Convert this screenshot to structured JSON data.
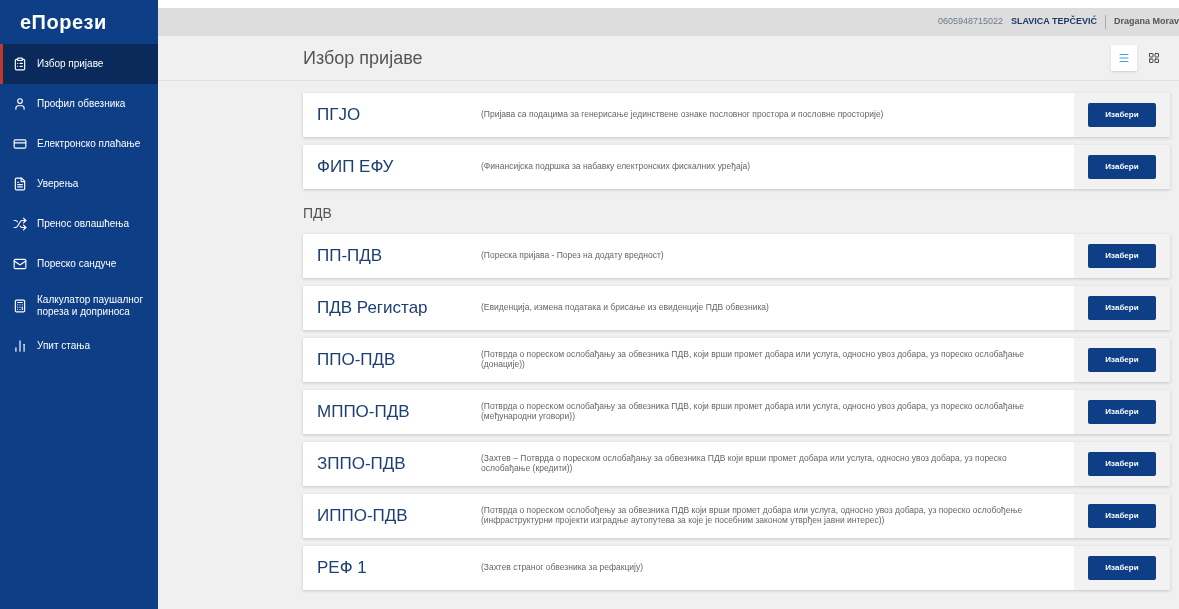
{
  "logo": "еПорези",
  "sidebar": {
    "items": [
      {
        "kind": "list",
        "label": "Избор пријаве",
        "selected": true
      },
      {
        "kind": "profile",
        "label": "Профил обвезника",
        "selected": false
      },
      {
        "kind": "card",
        "label": "Електронско плаћање",
        "selected": false
      },
      {
        "kind": "certificate",
        "label": "Уверења",
        "selected": false
      },
      {
        "kind": "transfer",
        "label": "Пренос овлашћења",
        "selected": false
      },
      {
        "kind": "mail",
        "label": "Пореско сандуче",
        "selected": false
      },
      {
        "kind": "calculator",
        "label": "Калкулатор паушалног пореза и доприноса",
        "selected": false
      },
      {
        "kind": "chart",
        "label": "Упит стања",
        "selected": false
      }
    ]
  },
  "header": {
    "id_number": "0605948715022",
    "user_name": "SLAVICA TEPČEVIĆ",
    "other_user": "Dragana Morav"
  },
  "page_title": "Избор пријаве",
  "view_toggle": [
    {
      "kind": "list",
      "selected": true
    },
    {
      "kind": "grid",
      "selected": false
    }
  ],
  "sections": [
    {
      "items": [
        {
          "code": "ПГЈО",
          "description": "(Пријава са подацима за генерисање јединствене ознаке пословног простора и пословне просторије)",
          "button": "Изабери"
        },
        {
          "code": "ФИП ЕФУ",
          "description": "(Финансијска подршка за набавку електронских фискалних уређаја)",
          "button": "Изабери"
        }
      ]
    },
    {
      "heading": "ПДВ",
      "items": [
        {
          "code": "ПП-ПДВ",
          "description": "(Пореска пријава - Порез на додату вредност)",
          "button": "Изабери"
        },
        {
          "code": "ПДВ Регистар",
          "description": "(Евиденција, измена података и брисање из евиденције ПДВ обвезника)",
          "button": "Изабери"
        },
        {
          "code": "ППО-ПДВ",
          "description": "(Потврда о пореском ослобађању за обвезника ПДВ, који врши промет добара или услуга, односно увоз добара, уз пореско ослобађање (донације))",
          "button": "Изабери"
        },
        {
          "code": "МППО-ПДВ",
          "description": "(Потврда о пореском ослобађању за обвезника ПДВ, који врши промет добара или услуга, односно увоз добара, уз пореско ослобађање (међународни уговори))",
          "button": "Изабери"
        },
        {
          "code": "ЗППО-ПДВ",
          "description": "(Захтев – Потврда о пореском ослобађању за обвезника ПДВ који врши промет добара или услуга, односно увоз добара, уз пореско ослобађање (кредити))",
          "button": "Изабери"
        },
        {
          "code": "ИППО-ПДВ",
          "description": "(Потврда о пореском ослобођењу за обвезника ПДВ који врши промет добара или услуга, односно увоз добара, уз пореско ослобођење (инфраструктурни пројекти изградње аутопутева за које је посебним законом утврђен јавни интерес))",
          "button": "Изабери"
        },
        {
          "code": "РЕФ 1",
          "description": "(Захтев страног обвезника за рефакцију)",
          "button": "Изабери"
        }
      ]
    }
  ]
}
